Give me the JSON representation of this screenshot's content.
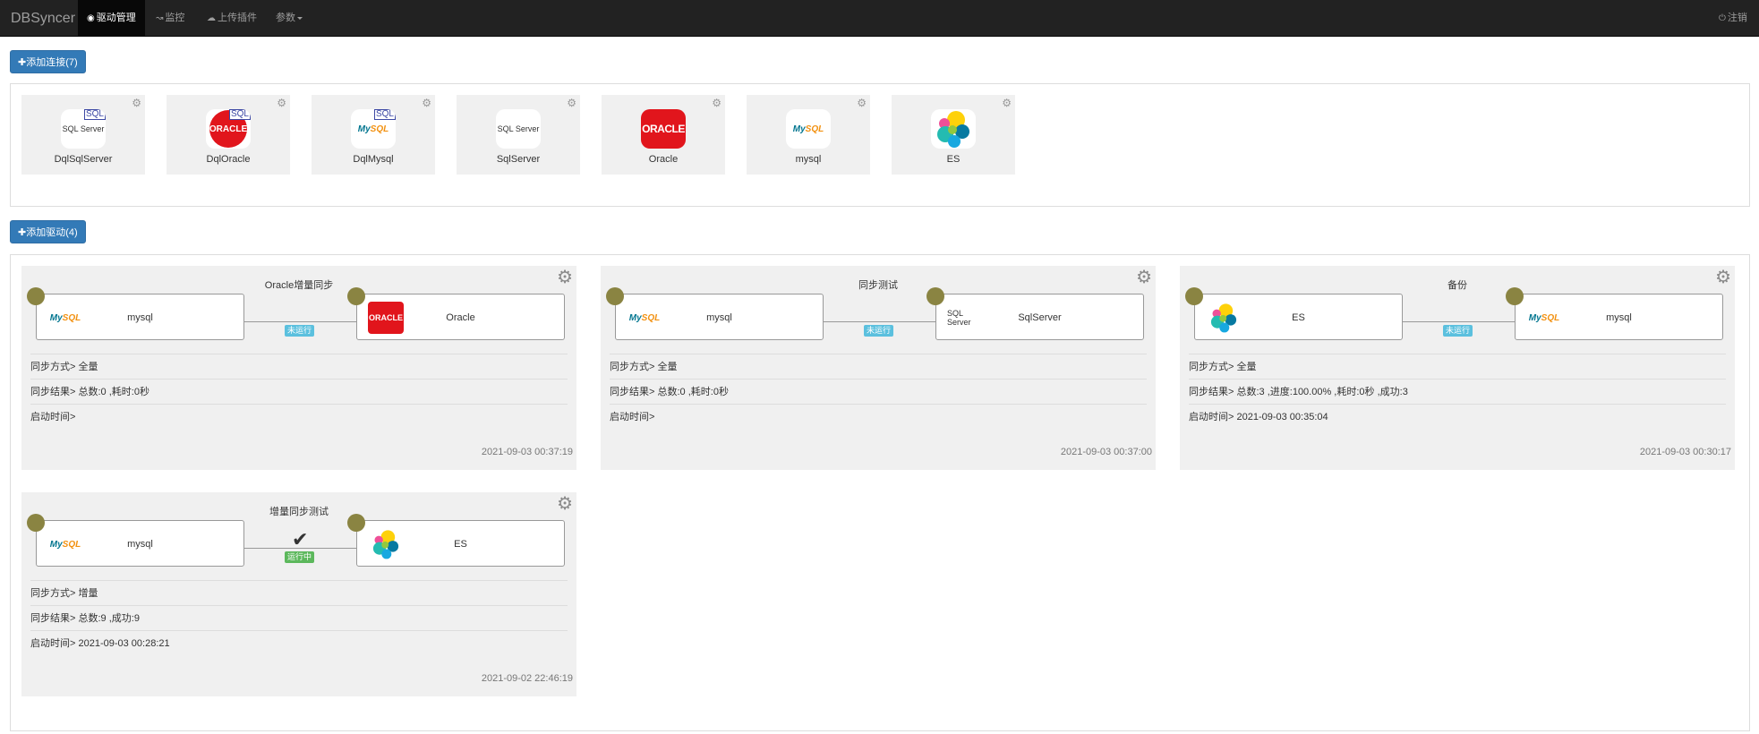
{
  "navbar": {
    "brand": "DBSyncer",
    "items": [
      {
        "icon": "dashboard-icon",
        "label": "驱动管理",
        "active": true
      },
      {
        "icon": "chart-icon",
        "label": "监控"
      },
      {
        "icon": "cloud-upload-icon",
        "label": "上传插件"
      },
      {
        "label": "参数"
      }
    ],
    "logout": "注销"
  },
  "connections": {
    "add_button": "添加连接(7)",
    "items": [
      {
        "name": "DqlSqlServer",
        "logo": "sqlserver-icon",
        "badge": "SQL"
      },
      {
        "name": "DqlOracle",
        "logo": "oracle-icon",
        "badge": "SQL"
      },
      {
        "name": "DqlMysql",
        "logo": "mysql-icon",
        "badge": "SQL"
      },
      {
        "name": "SqlServer",
        "logo": "sqlserver-icon"
      },
      {
        "name": "Oracle",
        "logo": "oracle-icon"
      },
      {
        "name": "mysql",
        "logo": "mysql-icon"
      },
      {
        "name": "ES",
        "logo": "elasticsearch-icon"
      }
    ],
    "logo_text": {
      "oracle": "ORACLE",
      "mysql_a": "My",
      "mysql_b": "SQL",
      "sqlserver": "SQL Server"
    }
  },
  "drivers": {
    "add_button": "添加驱动(4)",
    "items": [
      {
        "title": "Oracle增量同步",
        "source": {
          "name": "mysql",
          "logo": "mysql-icon"
        },
        "target": {
          "name": "Oracle",
          "logo": "oracle-icon"
        },
        "status": "未运行",
        "running": false,
        "sync_mode": "同步方式> 全量",
        "sync_result": "同步结果> 总数:0 ,耗时:0秒",
        "start_time": "启动时间>",
        "updated": "2021-09-03 00:37:19"
      },
      {
        "title": "同步测试",
        "source": {
          "name": "mysql",
          "logo": "mysql-icon"
        },
        "target": {
          "name": "SqlServer",
          "logo": "sqlserver-icon"
        },
        "status": "未运行",
        "running": false,
        "sync_mode": "同步方式> 全量",
        "sync_result": "同步结果> 总数:0 ,耗时:0秒",
        "start_time": "启动时间>",
        "updated": "2021-09-03 00:37:00"
      },
      {
        "title": "备份",
        "source": {
          "name": "ES",
          "logo": "elasticsearch-icon"
        },
        "target": {
          "name": "mysql",
          "logo": "mysql-icon"
        },
        "status": "未运行",
        "running": false,
        "sync_mode": "同步方式> 全量",
        "sync_result": "同步结果> 总数:3 ,进度:100.00% ,耗时:0秒 ,成功:3",
        "start_time": "启动时间> 2021-09-03 00:35:04",
        "updated": "2021-09-03 00:30:17"
      },
      {
        "title": "增量同步测试",
        "source": {
          "name": "mysql",
          "logo": "mysql-icon"
        },
        "target": {
          "name": "ES",
          "logo": "elasticsearch-icon"
        },
        "status": "运行中",
        "running": true,
        "sync_mode": "同步方式> 增量",
        "sync_result": "同步结果> 总数:9 ,成功:9",
        "start_time": "启动时间> 2021-09-03 00:28:21",
        "updated": "2021-09-02 22:46:19"
      }
    ]
  },
  "colors": {
    "navbar": "#222222",
    "primary": "#337ab7",
    "card": "#f0f0f0",
    "dot": "#8a8442",
    "status_stopped": "#5bc0de",
    "status_running": "#5cb85c",
    "oracle_red": "#e1151c"
  }
}
